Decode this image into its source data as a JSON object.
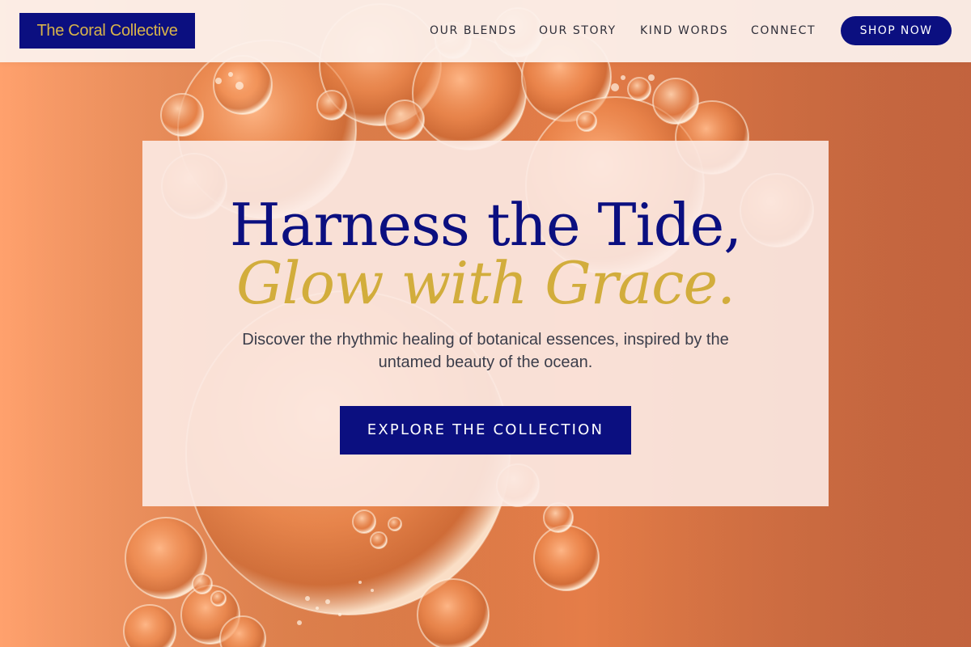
{
  "header": {
    "brand": "The Coral Collective",
    "nav": [
      "OUR BLENDS",
      "OUR STORY",
      "KIND WORDS",
      "CONNECT"
    ],
    "shop_label": "SHOP NOW"
  },
  "hero": {
    "headline_line1": "Harness the Tide,",
    "headline_line2": "Glow with Grace.",
    "subtext": "Discover the rhythmic healing of botanical essences, inspired by the untamed beauty of the ocean.",
    "cta_label": "EXPLORE THE COLLECTION"
  },
  "colors": {
    "navy": "#0b0f80",
    "gold": "#d2ad3c",
    "coral": "#f0884f",
    "card": "#fcebe5"
  }
}
